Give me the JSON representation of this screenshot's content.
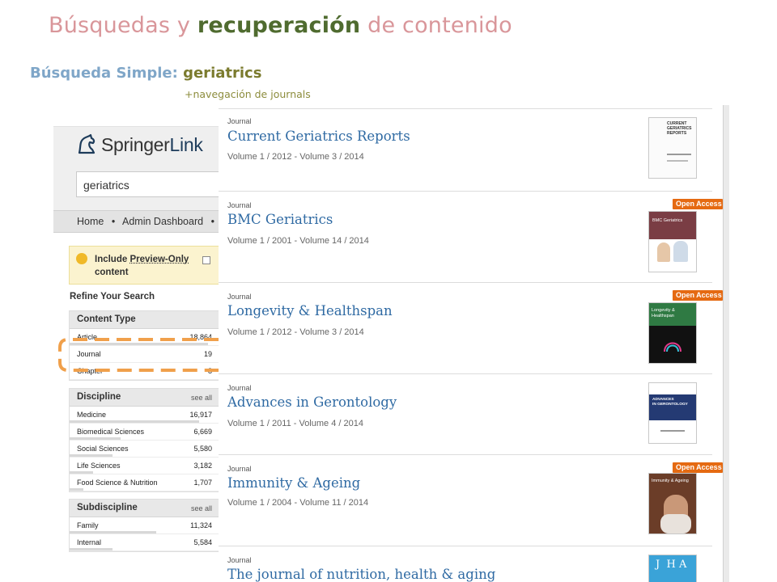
{
  "slide": {
    "title_part1": "Búsquedas y ",
    "title_part2": "recuperación",
    "title_part3": " de contenido",
    "subtitle_label": "Búsqueda Simple:",
    "subtitle_term": "geriatrics",
    "nav_note": "+navegación de journals"
  },
  "springer": {
    "logo_part1": "Springer",
    "logo_part2": "Link",
    "search_value": "geriatrics",
    "breadcrumbs": [
      "Home",
      "•",
      "Admin Dashboard",
      "•"
    ],
    "preview_line1": "Include ",
    "preview_link": "Preview-Only",
    "preview_line2": "content",
    "refine_label": "Refine Your Search",
    "content_type": {
      "title": "Content Type",
      "rows": [
        {
          "label": "Article",
          "count": "18,864",
          "level": 0.93
        },
        {
          "label": "Journal",
          "count": "19",
          "level": 0.0
        },
        {
          "label": "Chapter",
          "count": "8",
          "level": 0.0
        }
      ]
    },
    "discipline": {
      "title": "Discipline",
      "see_all": "see all",
      "rows": [
        {
          "label": "Medicine",
          "count": "16,917",
          "level": 0.87
        },
        {
          "label": "Biomedical Sciences",
          "count": "6,669",
          "level": 0.34
        },
        {
          "label": "Social Sciences",
          "count": "5,580",
          "level": 0.29
        },
        {
          "label": "Life Sciences",
          "count": "3,182",
          "level": 0.16
        },
        {
          "label": "Food Science & Nutrition",
          "count": "1,707",
          "level": 0.09
        }
      ]
    },
    "subdiscipline": {
      "title": "Subdiscipline",
      "see_all": "see all",
      "rows": [
        {
          "label": "Family",
          "count": "11,324",
          "level": 0.58
        },
        {
          "label": "Internal",
          "count": "5,584",
          "level": 0.29
        }
      ]
    }
  },
  "results": [
    {
      "type": "Journal",
      "title": "Current Geriatrics Reports",
      "volumes": "Volume 1 / 2012 - Volume 3 / 2014",
      "open_access": "",
      "cover": "current-geriatrics-reports-cover"
    },
    {
      "type": "Journal",
      "title": "BMC Geriatrics",
      "volumes": "Volume 1 / 2001 - Volume 14 / 2014",
      "open_access": "Open Access",
      "cover": "bmc-geriatrics-cover"
    },
    {
      "type": "Journal",
      "title": "Longevity & Healthspan",
      "volumes": "Volume 1 / 2012 - Volume 3 / 2014",
      "open_access": "Open Access",
      "cover": "longevity-healthspan-cover"
    },
    {
      "type": "Journal",
      "title": "Advances in Gerontology",
      "volumes": "Volume 1 / 2011 - Volume 4 / 2014",
      "open_access": "",
      "cover": "advances-gerontology-cover"
    },
    {
      "type": "Journal",
      "title": "Immunity & Ageing",
      "volumes": "Volume 1 / 2004 - Volume 11 / 2014",
      "open_access": "Open Access",
      "cover": "immunity-ageing-cover"
    },
    {
      "type": "Journal",
      "title": "The journal of nutrition, health & aging",
      "volumes": "",
      "open_access": "",
      "cover": "nutrition-health-aging-cover"
    }
  ],
  "covers": {
    "cgr": {
      "line1": "CURRENT",
      "line2": "GERIATRICS",
      "line3": "REPORTS"
    },
    "bmc": {
      "title": "BMC Geriatrics"
    },
    "lh": {
      "title1": "Longevity &",
      "title2": "Healthspan"
    },
    "ag": {
      "title1": "ADVANCES",
      "title2": "IN GERONTOLOGY"
    },
    "ia": {
      "title": "Immunity & Ageing"
    },
    "jnha": {
      "title": "J  H A"
    }
  }
}
